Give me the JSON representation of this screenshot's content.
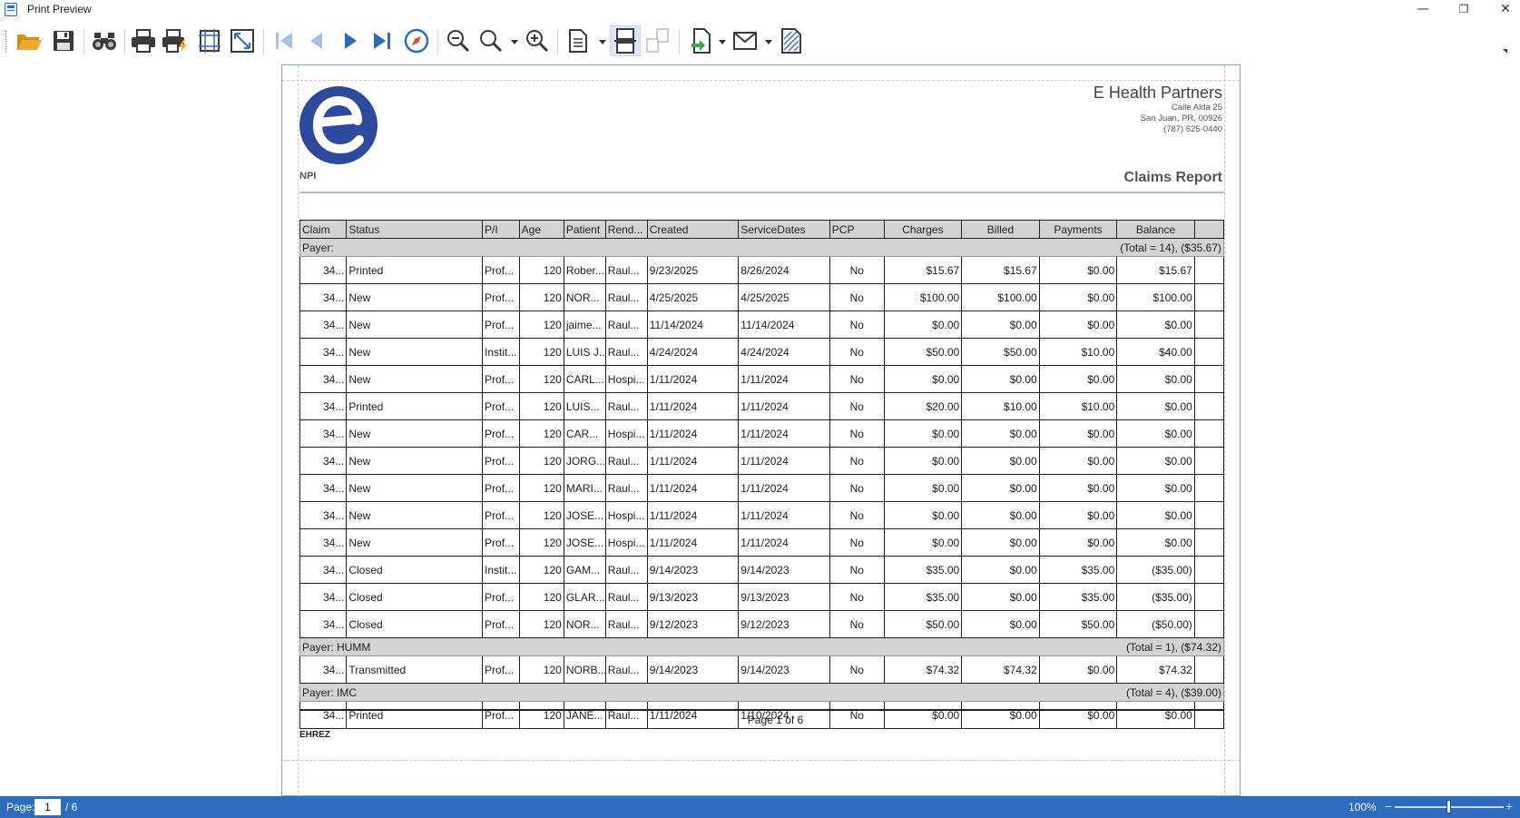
{
  "window": {
    "title": "Print Preview",
    "minimize": "—",
    "restore": "❐",
    "close": "✕"
  },
  "toolbar": {
    "items": [
      "open-icon",
      "save-icon",
      "find-icon",
      "print-icon",
      "quick-print-icon",
      "page-setup-icon",
      "scale-icon",
      "first-page-icon",
      "previous-page-icon",
      "next-page-icon",
      "last-page-icon",
      "navigation-icon",
      "zoom-out-icon",
      "zoom-icon",
      "zoom-in-icon",
      "page-layout-icon",
      "multiple-pages-icon",
      "continuous-icon",
      "export-icon",
      "send-email-icon",
      "watermark-icon"
    ]
  },
  "report": {
    "company_name": "E Health Partners",
    "address_line1": "Calle Alda 25",
    "address_line2": "San Juan, PR, 00926",
    "phone": "(787) 625-0440",
    "npi_label": "NPI",
    "title": "Claims Report",
    "columns": [
      "Claim",
      "Status",
      "P/I",
      "Age",
      "Patient",
      "Rend...",
      "Created",
      "ServiceDates",
      "PCP",
      "Charges",
      "Billed",
      "Payments",
      "Balance"
    ],
    "groups": [
      {
        "label": "Payer:",
        "summary": "(Total = 14), ($35.67)",
        "rows": [
          [
            "34...",
            "Printed",
            "Prof...",
            "120",
            "Rober...",
            "Raul...",
            "9/23/2025",
            "8/26/2024",
            "No",
            "$15.67",
            "$15.67",
            "$0.00",
            "$15.67"
          ],
          [
            "34...",
            "New",
            "Prof...",
            "120",
            "NOR...",
            "Raul...",
            "4/25/2025",
            "4/25/2025",
            "No",
            "$100.00",
            "$100.00",
            "$0.00",
            "$100.00"
          ],
          [
            "34...",
            "New",
            "Prof...",
            "120",
            "jaime...",
            "Raul...",
            "11/14/2024",
            "11/14/2024",
            "No",
            "$0.00",
            "$0.00",
            "$0.00",
            "$0.00"
          ],
          [
            "34...",
            "New",
            "Instit...",
            "120",
            "LUIS J...",
            "Raul...",
            "4/24/2024",
            "4/24/2024",
            "No",
            "$50.00",
            "$50.00",
            "$10.00",
            "$40.00"
          ],
          [
            "34...",
            "New",
            "Prof...",
            "120",
            "CARL...",
            "Hospi...",
            "1/11/2024",
            "1/11/2024",
            "No",
            "$0.00",
            "$0.00",
            "$0.00",
            "$0.00"
          ],
          [
            "34...",
            "Printed",
            "Prof...",
            "120",
            "LUIS...",
            "Raul...",
            "1/11/2024",
            "1/11/2024",
            "No",
            "$20.00",
            "$10.00",
            "$10.00",
            "$0.00"
          ],
          [
            "34...",
            "New",
            "Prof...",
            "120",
            "CAR...",
            "Hospi...",
            "1/11/2024",
            "1/11/2024",
            "No",
            "$0.00",
            "$0.00",
            "$0.00",
            "$0.00"
          ],
          [
            "34...",
            "New",
            "Prof...",
            "120",
            "JORG...",
            "Raul...",
            "1/11/2024",
            "1/11/2024",
            "No",
            "$0.00",
            "$0.00",
            "$0.00",
            "$0.00"
          ],
          [
            "34...",
            "New",
            "Prof...",
            "120",
            "MARI...",
            "Raul...",
            "1/11/2024",
            "1/11/2024",
            "No",
            "$0.00",
            "$0.00",
            "$0.00",
            "$0.00"
          ],
          [
            "34...",
            "New",
            "Prof...",
            "120",
            "JOSE...",
            "Hospi...",
            "1/11/2024",
            "1/11/2024",
            "No",
            "$0.00",
            "$0.00",
            "$0.00",
            "$0.00"
          ],
          [
            "34...",
            "New",
            "Prof...",
            "120",
            "JOSE...",
            "Hospi...",
            "1/11/2024",
            "1/11/2024",
            "No",
            "$0.00",
            "$0.00",
            "$0.00",
            "$0.00"
          ],
          [
            "34...",
            "Closed",
            "Instit...",
            "120",
            "GAM...",
            "Raul...",
            "9/14/2023",
            "9/14/2023",
            "No",
            "$35.00",
            "$0.00",
            "$35.00",
            "($35.00)"
          ],
          [
            "34...",
            "Closed",
            "Prof...",
            "120",
            "GLAR...",
            "Raul...",
            "9/13/2023",
            "9/13/2023",
            "No",
            "$35.00",
            "$0.00",
            "$35.00",
            "($35.00)"
          ],
          [
            "34...",
            "Closed",
            "Prof...",
            "120",
            "NOR...",
            "Raul...",
            "9/12/2023",
            "9/12/2023",
            "No",
            "$50.00",
            "$0.00",
            "$50.00",
            "($50.00)"
          ]
        ]
      },
      {
        "label": "Payer: HUMM",
        "summary": "(Total = 1), ($74.32)",
        "rows": [
          [
            "34...",
            "Transmitted",
            "Prof...",
            "120",
            "NORB...",
            "Raul...",
            "9/14/2023",
            "9/14/2023",
            "No",
            "$74.32",
            "$74.32",
            "$0.00",
            "$74.32"
          ]
        ]
      },
      {
        "label": "Payer: IMC",
        "summary": "(Total = 4), ($39.00)",
        "rows": [
          [
            "34...",
            "Printed",
            "Prof...",
            "120",
            "JANE...",
            "Raul...",
            "1/11/2024",
            "1/10/2024",
            "No",
            "$0.00",
            "$0.00",
            "$0.00",
            "$0.00"
          ]
        ]
      }
    ],
    "page_of": "Page 1 of 6",
    "footer_user": "EHREZ"
  },
  "status": {
    "page_label": "Page:",
    "current_page": "1",
    "total_pages": "/ 6",
    "zoom_level": "100%",
    "zoom_fraction": 0.5
  },
  "colors": {
    "accent_blue": "#2d6cc0",
    "logo_blue": "#2e4a9e",
    "header_grey": "#d3d3d3"
  }
}
